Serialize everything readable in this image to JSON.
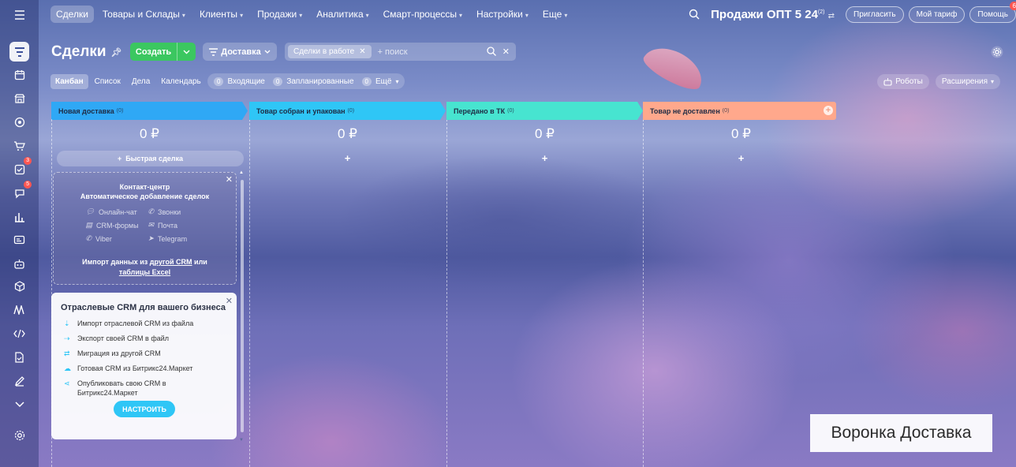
{
  "topnav": {
    "items": [
      {
        "label": "Сделки",
        "active": true,
        "caret": false
      },
      {
        "label": "Товары и Склады",
        "caret": true
      },
      {
        "label": "Клиенты",
        "caret": true
      },
      {
        "label": "Продажи",
        "caret": true
      },
      {
        "label": "Аналитика",
        "caret": true
      },
      {
        "label": "Смарт-процессы",
        "caret": true
      },
      {
        "label": "Настройки",
        "caret": true
      },
      {
        "label": "Еще",
        "caret": true
      }
    ],
    "portal": "Продажи ОПТ 5 24",
    "portal_sup": "(2)",
    "invite": "Пригласить",
    "tariff": "Мой тариф",
    "help": "Помощь",
    "help_badge": "6"
  },
  "rail": {
    "badges": {
      "tasks": "3",
      "chat": "5"
    }
  },
  "toolbar": {
    "title": "Сделки",
    "create": "Создать",
    "funnel": "Доставка",
    "filter_tag": "Сделки в работе",
    "search_placeholder": "+ поиск"
  },
  "views": {
    "tabs": [
      "Канбан",
      "Список",
      "Дела",
      "Календарь"
    ],
    "counters": [
      {
        "n": "0",
        "label": "Входящие"
      },
      {
        "n": "0",
        "label": "Запланированные"
      },
      {
        "n": "0",
        "label": "Ещё"
      }
    ],
    "robots": "Роботы",
    "extensions": "Расширения"
  },
  "columns": [
    {
      "title": "Новая доставка",
      "count": "(0)",
      "sum": "0 ₽",
      "color": "#2fa8f5"
    },
    {
      "title": "Товар собран и упакован",
      "count": "(0)",
      "sum": "0 ₽",
      "color": "#2fc6f6"
    },
    {
      "title": "Передано в ТК",
      "count": "(0)",
      "sum": "0 ₽",
      "color": "#47e4d0"
    },
    {
      "title": "Товар не доставлен",
      "count": "(0)",
      "sum": "0 ₽",
      "color": "#ffa88c"
    }
  ],
  "quick_deal": "Быстрая сделка",
  "contact_center": {
    "title1": "Контакт-центр",
    "title2": "Автоматическое добавление сделок",
    "channels": [
      "Онлайн-чат",
      "Звонки",
      "CRM-формы",
      "Почта",
      "Viber",
      "Telegram"
    ],
    "import_prefix": "Импорт данных из ",
    "import_link1": "другой CRM",
    "import_mid": " или ",
    "import_link2": "таблицы Excel"
  },
  "crm_card": {
    "title": "Отраслевые CRM для вашего бизнеса",
    "items": [
      "Импорт отраслевой CRM из файла",
      "Экспорт своей CRM в файл",
      "Миграция из другой CRM",
      "Готовая CRM из Битрикс24.Маркет",
      "Опубликовать свою CRM в Битрикс24.Маркет"
    ],
    "button": "НАСТРОИТЬ"
  },
  "overlay_label": "Воронка Доставка"
}
